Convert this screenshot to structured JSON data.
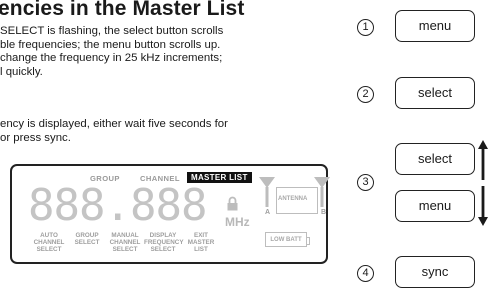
{
  "title": "encies in the Master List",
  "para1": [
    "SELECT is flashing, the select button scrolls",
    "ble frequencies; the menu button scrolls up.",
    "change the frequency in 25 kHz increments;",
    "l quickly."
  ],
  "para2": [
    "ency is displayed, either wait five seconds for",
    "or press sync."
  ],
  "lcd": {
    "group": "GROUP",
    "channel": "CHANNEL",
    "master_list": "MASTER LIST",
    "digits": "888.888",
    "mhz": "MHz",
    "antenna": "ANTENNA",
    "a": "A",
    "b": "B",
    "low_batt": "LOW BATT",
    "labels": [
      [
        "AUTO",
        "CHANNEL",
        "SELECT"
      ],
      [
        "GROUP",
        "SELECT",
        ""
      ],
      [
        "MANUAL",
        "CHANNEL",
        "SELECT"
      ],
      [
        "DISPLAY",
        "FREQUENCY",
        "SELECT"
      ],
      [
        "EXIT",
        "MASTER",
        "LIST"
      ]
    ]
  },
  "steps": [
    {
      "num": "1",
      "buttons": [
        "menu"
      ]
    },
    {
      "num": "2",
      "buttons": [
        "select"
      ]
    },
    {
      "num": "3",
      "buttons": [
        "select",
        "menu"
      ]
    },
    {
      "num": "4",
      "buttons": [
        "sync"
      ]
    }
  ]
}
